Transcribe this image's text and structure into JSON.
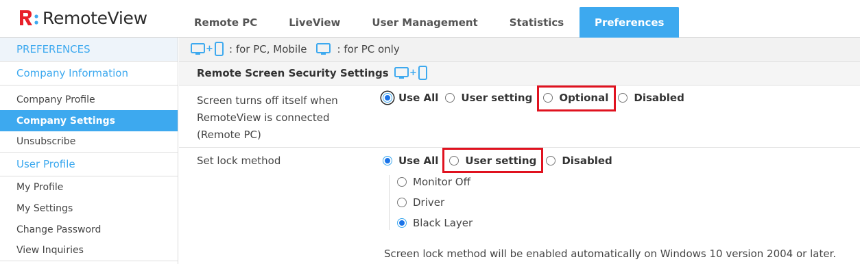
{
  "header": {
    "logo_text": "RemoteView",
    "tabs": [
      {
        "label": "Remote PC"
      },
      {
        "label": "LiveView"
      },
      {
        "label": "User Management"
      },
      {
        "label": "Statistics"
      },
      {
        "label": "Preferences",
        "active": true
      }
    ]
  },
  "sidebar": {
    "heading": "PREFERENCES",
    "company_group": "Company Information",
    "company_items": [
      {
        "label": "Company Profile"
      },
      {
        "label": "Company Settings",
        "active": true
      },
      {
        "label": "Unsubscribe"
      }
    ],
    "user_group": "User Profile",
    "user_items": [
      {
        "label": "My Profile"
      },
      {
        "label": "My Settings"
      },
      {
        "label": "Change Password"
      },
      {
        "label": "View Inquiries"
      }
    ]
  },
  "legend": {
    "pc_mobile": ": for PC, Mobile",
    "pc_only": ": for PC only"
  },
  "section": {
    "title": "Remote Screen Security Settings"
  },
  "screen_off": {
    "label": "Screen turns off itself when RemoteView is connected (Remote PC)",
    "options": [
      "Use All",
      "User setting",
      "Optional",
      "Disabled"
    ],
    "selected": "Use All"
  },
  "lock_method": {
    "label": "Set lock method",
    "options": [
      "Use All",
      "User setting",
      "Disabled"
    ],
    "selected": "Use All",
    "sub_options": [
      "Monitor Off",
      "Driver",
      "Black Layer"
    ],
    "sub_selected": "Black Layer",
    "note": "Screen lock method will be enabled automatically on Windows 10 version 2004 or later."
  },
  "colors": {
    "accent": "#3da9ef",
    "highlight": "#e0121f",
    "logo_red": "#e8202a"
  }
}
